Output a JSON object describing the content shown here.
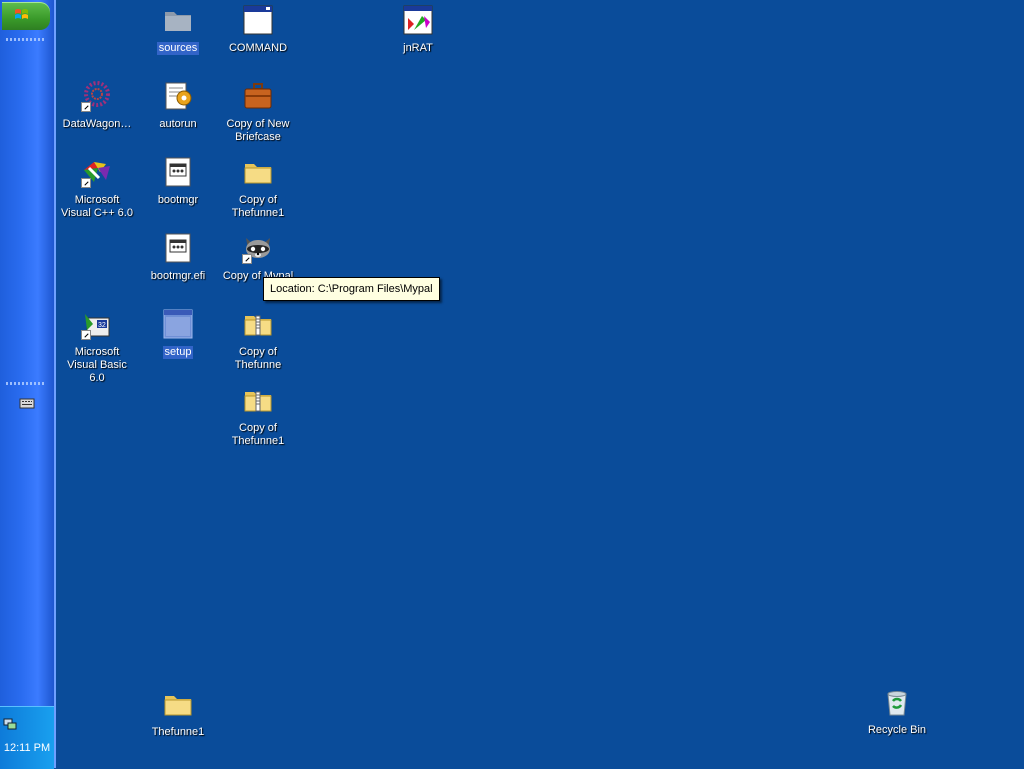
{
  "desktop": {
    "background_color": "#0a4c9a",
    "icons": [
      {
        "label": "sources",
        "icon": "folder-gray-icon",
        "selected": true
      },
      {
        "label": "COMMAND",
        "icon": "window-icon",
        "selected": false
      },
      {
        "label": "jnRAT",
        "icon": "jnrat-app-icon",
        "selected": false
      },
      {
        "label": "DataWagon…",
        "icon": "datawagon-icon",
        "selected": false
      },
      {
        "label": "autorun",
        "icon": "autorun-icon",
        "selected": false
      },
      {
        "label": "Copy of New Briefcase",
        "icon": "briefcase-icon",
        "selected": false
      },
      {
        "label": "Microsoft Visual C++ 6.0",
        "icon": "visual-cpp-icon",
        "selected": false
      },
      {
        "label": "bootmgr",
        "icon": "system-file-icon",
        "selected": false
      },
      {
        "label": "Copy of Thefunne1",
        "icon": "folder-icon",
        "selected": false
      },
      {
        "label": "bootmgr.efi",
        "icon": "system-file-icon",
        "selected": false
      },
      {
        "label": "Copy of Mypal",
        "icon": "raccoon-icon",
        "selected": false
      },
      {
        "label": "Microsoft Visual Basic 6.0",
        "icon": "visual-basic-icon",
        "selected": false
      },
      {
        "label": "setup",
        "icon": "setup-window-icon",
        "selected": true
      },
      {
        "label": "Copy of Thefunne",
        "icon": "zip-folder-icon",
        "selected": false
      },
      {
        "label": "Copy of Thefunne1",
        "icon": "zip-folder-icon",
        "selected": false
      },
      {
        "label": "Thefunne1",
        "icon": "folder-icon",
        "selected": false
      },
      {
        "label": "Recycle Bin",
        "icon": "recycle-bin-icon",
        "selected": false
      }
    ]
  },
  "tooltip": {
    "text": "Location: C:\\Program Files\\Mypal"
  },
  "taskbar": {
    "start_icon": "windows-flag-icon",
    "quick_launch_icon": "keyboard-icon",
    "tray_icon": "network-icon",
    "clock": "12:11 PM"
  },
  "colors": {
    "taskbar": "#2a6cf0",
    "start": "#3a9a2a",
    "tray": "#19a0ef"
  }
}
